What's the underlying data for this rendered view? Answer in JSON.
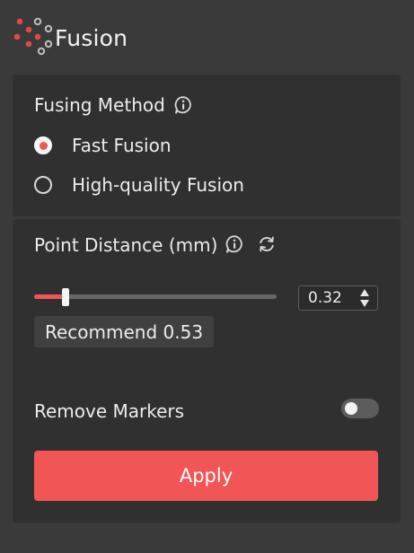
{
  "header": {
    "title": "Fusion"
  },
  "fusing_method": {
    "label": "Fusing Method",
    "options": [
      {
        "label": "Fast Fusion",
        "selected": true
      },
      {
        "label": "High-quality Fusion",
        "selected": false
      }
    ]
  },
  "point_distance": {
    "label": "Point Distance (mm)",
    "value": "0.32",
    "slider_fraction": 0.13,
    "recommend": "Recommend 0.53"
  },
  "remove_markers": {
    "label": "Remove Markers",
    "enabled": false
  },
  "apply": {
    "label": "Apply"
  },
  "colors": {
    "accent": "#f25555",
    "panel": "#303030",
    "background": "#3a3a3a",
    "text": "#ececec"
  },
  "icons": {
    "logo": "fusion-logo",
    "info": "info-icon",
    "reset": "refresh-icon",
    "spinner": "up-down-spinner-icon"
  }
}
